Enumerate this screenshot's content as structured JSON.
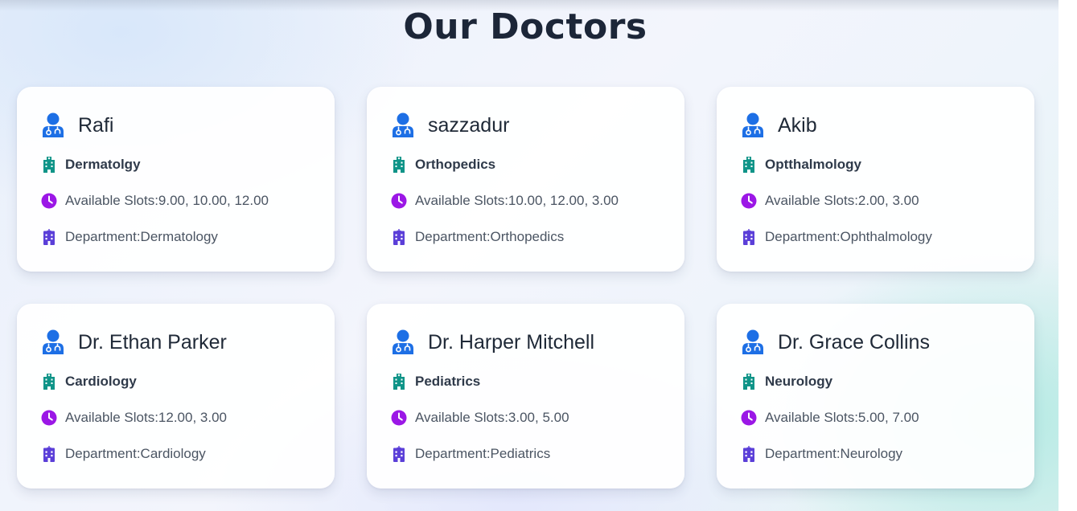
{
  "page": {
    "title": "Our Doctors"
  },
  "labels": {
    "slots_prefix": "Available Slots: ",
    "dept_prefix": "Department: "
  },
  "colors": {
    "doctor_icon": "#1d6fe5",
    "specialty_icon": "#0f9488",
    "clock_icon": "#9b17e6",
    "department_icon": "#5b3fd8"
  },
  "icons": {
    "doctor": "user-doctor-icon",
    "specialty": "hospital-building-icon",
    "slots": "clock-icon",
    "department": "hospital-icon"
  },
  "doctors": [
    {
      "name": "Rafi",
      "specialty": "Dermatolgy",
      "slots": "9.00, 10.00, 12.00",
      "department": "Dermatology"
    },
    {
      "name": "sazzadur",
      "specialty": "Orthopedics",
      "slots": "10.00, 12.00, 3.00",
      "department": "Orthopedics"
    },
    {
      "name": "Akib",
      "specialty": "Optthalmology",
      "slots": "2.00, 3.00",
      "department": "Ophthalmology"
    },
    {
      "name": "Dr. Ethan Parker",
      "specialty": "Cardiology",
      "slots": "12.00, 3.00",
      "department": "Cardiology"
    },
    {
      "name": "Dr. Harper Mitchell",
      "specialty": "Pediatrics",
      "slots": "3.00, 5.00",
      "department": "Pediatrics"
    },
    {
      "name": "Dr. Grace Collins",
      "specialty": "Neurology",
      "slots": "5.00, 7.00",
      "department": "Neurology"
    }
  ]
}
